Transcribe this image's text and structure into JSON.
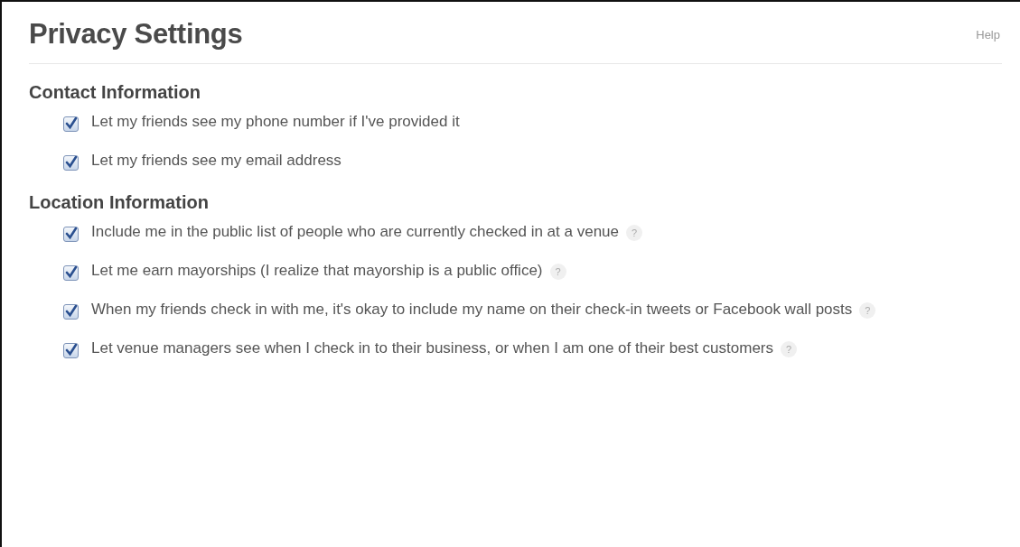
{
  "title": "Privacy Settings",
  "help_link": "Help",
  "sections": [
    {
      "heading": "Contact Information",
      "options": [
        {
          "label": "Let my friends see my phone number if I've provided it",
          "checked": true
        },
        {
          "label": "Let my friends see my email address",
          "checked": true
        }
      ]
    },
    {
      "heading": "Location Information",
      "options": [
        {
          "label": "Include me in the public list of people who are currently checked in at a venue",
          "checked": true,
          "hint": "?"
        },
        {
          "label": "Let me earn mayorships (I realize that mayorship is a public office)",
          "checked": true,
          "hint": "?"
        },
        {
          "label": "When my friends check in with me, it's okay to include my name on their check-in tweets or Facebook wall posts",
          "checked": true,
          "hint": "?"
        },
        {
          "label": "Let venue managers see when I check in to their business, or when I am one of their best customers",
          "checked": true,
          "hint": "?"
        }
      ]
    }
  ]
}
